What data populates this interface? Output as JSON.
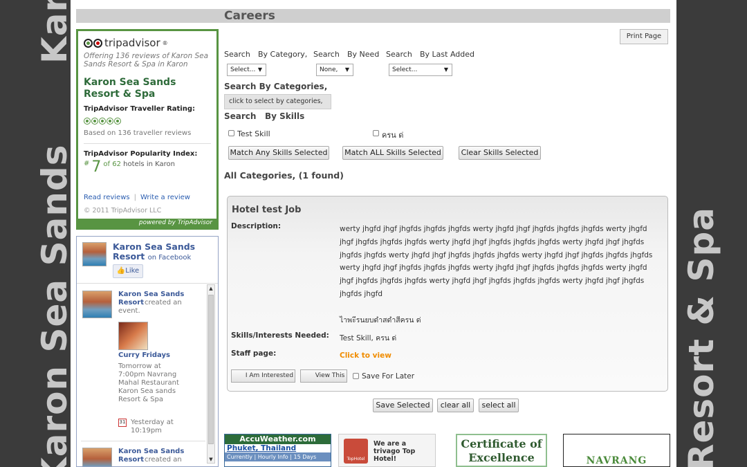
{
  "side": {
    "left_text": "Karon Sea Sands",
    "right_text": "Resort & Spa"
  },
  "page": {
    "title": "Careers",
    "print_label": "Print Page"
  },
  "tripadvisor": {
    "logo": "tripadvisor",
    "offering": "Offering 136 reviews of Karon Sea Sands Resort & Spa in Karon",
    "hotel": "Karon Sea Sands Resort & Spa",
    "rating_label": "TripAdvisor Traveller Rating:",
    "rating_bubbles": 5,
    "based_on": "Based on 136 traveller reviews",
    "popularity_label": "TripAdvisor Popularity Index:",
    "rank": "7",
    "rank_of": "of 62",
    "rank_rest": "hotels in Karon",
    "read_reviews": "Read reviews",
    "write_review": "Write a review",
    "copyright": "© 2011 TripAdvisor LLC",
    "powered": "powered by TripAdvisor"
  },
  "facebook": {
    "page_name": "Karon Sea Sands Resort",
    "on_facebook": "on Facebook",
    "like": "Like",
    "post1_name": "Karon Sea Sands Resort",
    "post1_action": "created an event.",
    "event_name": "Curry Fridays",
    "event_details": "Tomorrow at 7:00pm Navrang Mahal Restaurant Karon Sea sands Resort & Spa",
    "event_when": "Yesterday at 10:19pm",
    "post2_name": "Karon Sea Sands Resort",
    "post2_action": "created an"
  },
  "search": {
    "search_label": "Search",
    "by_category": "By Category,",
    "by_need": "By Need",
    "by_last_added": "By Last Added",
    "category_value": "Select...",
    "need_value": "None,",
    "last_added_value": "Select...",
    "by_categories_heading": "Search By Categories,",
    "categories_placeholder": "click to select by categories,",
    "by_skills_search": "Search",
    "by_skills": "By Skills",
    "skills": [
      "Test Skill",
      "ครน ด่"
    ],
    "match_any": "Match Any Skills Selected",
    "match_all": "Match ALL Skills Selected",
    "clear_skills": "Clear Skills Selected"
  },
  "results": {
    "heading": "All Categories, (1 found)",
    "job": {
      "title": "Hotel test Job",
      "description_label": "Description:",
      "description": "werty jhgfd jhgf jhgfds jhgfds jhgfds werty jhgfd jhgf jhgfds jhgfds jhgfds werty jhgfd jhgf jhgfds jhgfds jhgfds werty jhgfd jhgf jhgfds jhgfds jhgfds werty jhgfd jhgf jhgfds jhgfds jhgfds werty jhgfd jhgf jhgfds jhgfds jhgfds werty jhgfd jhgf jhgfds jhgfds jhgfds werty jhgfd jhgf jhgfds jhgfds jhgfds werty jhgfd jhgf jhgfds jhgfds jhgfds werty jhgfd jhgf jhgfds jhgfds jhgfds werty jhgfd jhgf jhgfds jhgfds jhgfds werty jhgfd jhgf jhgfds jhgfds jhgfd",
      "description_thai": "ไาพะีรนยบดำสดำสีครน ด่",
      "skills_label": "Skills/Interests Needed:",
      "skills_value": "Test Skill, ครน ด่",
      "staff_label": "Staff page:",
      "staff_link": "Click to view",
      "interested": "I Am Interested",
      "view_this": "View This",
      "save_later": "Save For Later"
    },
    "save_selected": "Save Selected",
    "clear_all": "clear all",
    "select_all": "select all"
  },
  "ads": {
    "accuweather": "AccuWeather.com",
    "accuweather_loc": "Phuket, Thailand",
    "accuweather_tabs": "Currently | Hourly Info | 15 Days",
    "trivago": "We are a trivago Top Hotel!",
    "trivago_badge": "TopHotel",
    "certificate": "Certificate of Excellence",
    "navrang": "NAVRANG MAHAL"
  },
  "colors": {
    "ta_green": "#589442",
    "fb_blue": "#3b5998",
    "link_orange": "#f08c00"
  }
}
